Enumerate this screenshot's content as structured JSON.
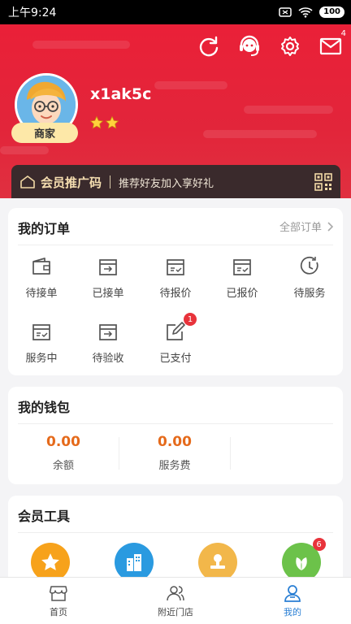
{
  "status_bar": {
    "time": "上午9:24",
    "battery": "100"
  },
  "header": {
    "mail_count": "4",
    "username": "x1ak5c",
    "role_badge": "商家"
  },
  "promo": {
    "title": "会员推广码",
    "subtitle": "推荐好友加入享好礼"
  },
  "orders": {
    "title": "我的订单",
    "all_link": "全部订单",
    "items": [
      {
        "label": "待接单",
        "icon": "wallet-icon"
      },
      {
        "label": "已接单",
        "icon": "box-arrow-icon"
      },
      {
        "label": "待报价",
        "icon": "box-check-icon"
      },
      {
        "label": "已报价",
        "icon": "box-check-icon"
      },
      {
        "label": "待服务",
        "icon": "clock-icon"
      },
      {
        "label": "服务中",
        "icon": "box-check-icon"
      },
      {
        "label": "待验收",
        "icon": "box-arrow-icon"
      },
      {
        "label": "已支付",
        "icon": "edit-icon",
        "badge": "1"
      }
    ]
  },
  "wallet": {
    "title": "我的钱包",
    "items": [
      {
        "value": "0.00",
        "label": "余额"
      },
      {
        "value": "0.00",
        "label": "服务费"
      }
    ]
  },
  "tools": {
    "title": "会员工具",
    "items": [
      {
        "icon": "star-icon",
        "color": "#f7a21b"
      },
      {
        "icon": "building-icon",
        "color": "#2a9ae0"
      },
      {
        "icon": "stamp-icon",
        "color": "#f2b74a"
      },
      {
        "icon": "leaf-icon",
        "color": "#6cc24a",
        "badge": "6"
      }
    ]
  },
  "tabbar": {
    "items": [
      {
        "label": "首页",
        "icon": "store-icon",
        "active": false
      },
      {
        "label": "附近门店",
        "icon": "people-icon",
        "active": false
      },
      {
        "label": "我的",
        "icon": "user-icon",
        "active": true
      }
    ]
  },
  "colors": {
    "header_red": "#e42338",
    "accent_orange": "#e56a1b",
    "active_blue": "#2a7fd4",
    "badge_red": "#e8333b"
  }
}
